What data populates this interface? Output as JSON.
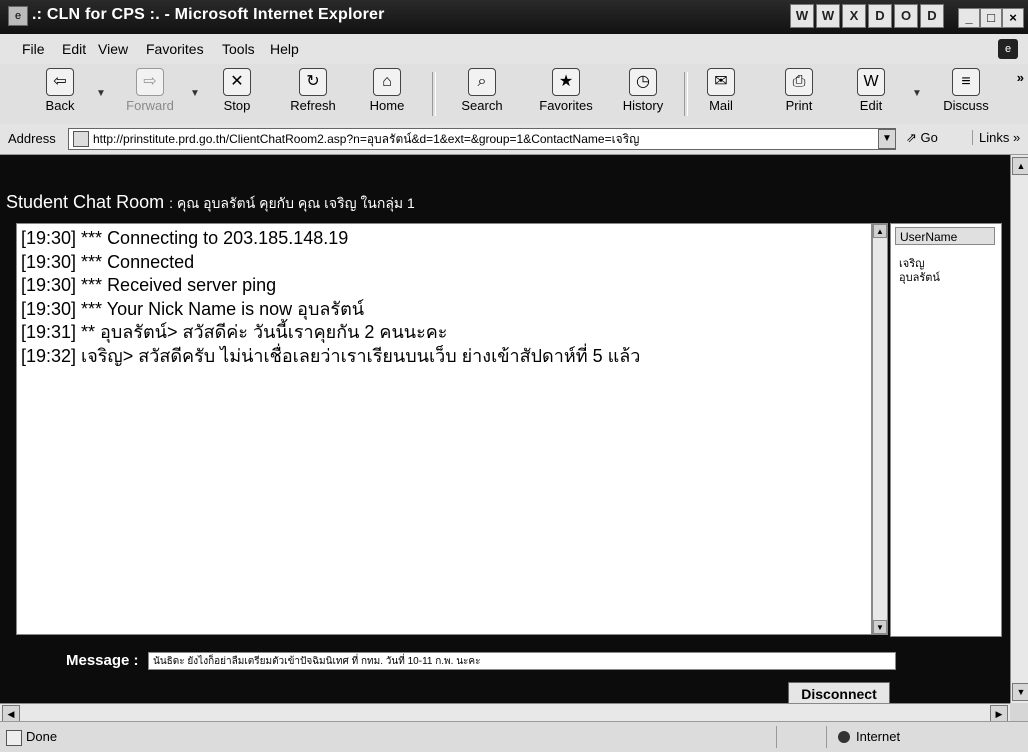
{
  "window": {
    "title": ".: CLN for CPS :. - Microsoft Internet Explorer",
    "tray_icons": [
      "W",
      "W",
      "X",
      "D",
      "O",
      "D"
    ],
    "controls": {
      "minimize": "_",
      "maximize": "□",
      "close": "×"
    }
  },
  "menu": [
    "File",
    "Edit",
    "View",
    "Favorites",
    "Tools",
    "Help"
  ],
  "toolbar": {
    "back": "Back",
    "forward": "Forward",
    "stop": "Stop",
    "refresh": "Refresh",
    "home": "Home",
    "search": "Search",
    "favorites": "Favorites",
    "history": "History",
    "mail": "Mail",
    "print": "Print",
    "edit": "Edit",
    "discuss": "Discuss",
    "more": "»"
  },
  "address": {
    "label": "Address",
    "url": "http://prinstitute.prd.go.th/ClientChatRoom2.asp?n=อุบลรัตน์&d=1&ext=&group=1&ContactName=เจริญ",
    "go": "Go",
    "links": "Links »"
  },
  "chat": {
    "room_title": "Student Chat Room",
    "room_subtitle": ": คุณ อุบลรัตน์ คุยกับ คุณ เจริญ ในกลุ่ม 1",
    "lines": [
      "[19:30] *** Connecting to 203.185.148.19",
      "[19:30] *** Connected",
      "[19:30] *** Received server ping",
      "[19:30] *** Your Nick Name is now อุบลรัตน์",
      "[19:31] ** อุบลรัตน์> สวัสดีค่ะ วันนี้เราคุยกัน 2 คนนะคะ",
      "[19:32] เจริญ> สวัสดีครับ   ไม่น่าเชื่อเลยว่าเราเรียนบนเว็บ ย่างเข้าสัปดาห์ที่ 5 แล้ว"
    ],
    "users_header": "UserName",
    "users": [
      "เจริญ",
      "อุบลรัตน์"
    ],
    "message_label": "Message :",
    "message_value": "นันธิดะ ยังไงก็อย่าลืมเตรียมตัวเข้าปัจฉิมนิเทศ ที่ กทม. วันที่ 10-11 ก.พ. นะคะ",
    "disconnect": "Disconnect"
  },
  "status": {
    "text": "Done",
    "zone": "Internet"
  }
}
